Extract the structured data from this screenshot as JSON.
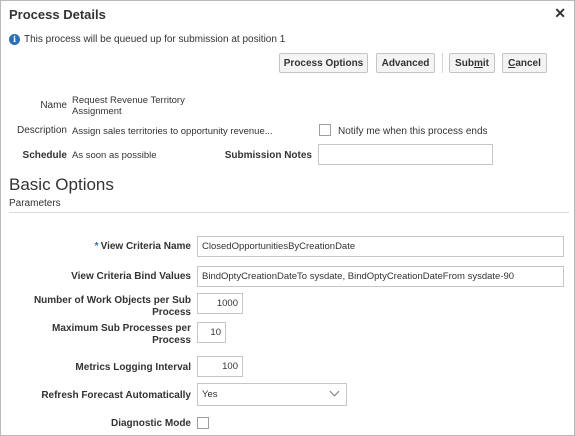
{
  "dialog": {
    "title": "Process Details",
    "close_icon": "close-icon",
    "info_message": "This process will be queued up for submission at position 1"
  },
  "toolbar": {
    "process_options": "Process Options",
    "advanced": "Advanced",
    "submit_pre": "Sub",
    "submit_u": "m",
    "submit_post": "it",
    "cancel_u": "C",
    "cancel_post": "ancel"
  },
  "details": {
    "name_label": "Name",
    "name_line1": "Request Revenue Territory",
    "name_line2": "Assignment",
    "description_label": "Description",
    "description_value": "Assign sales territories to opportunity revenue...",
    "notify_label": "Notify me when this process ends",
    "schedule_label": "Schedule",
    "schedule_value": "As soon as possible",
    "submission_notes_label": "Submission Notes",
    "submission_notes_value": ""
  },
  "basic_options": {
    "heading": "Basic Options",
    "parameters_label": "Parameters"
  },
  "params": {
    "required_marker": "*",
    "view_criteria_name_label": "View Criteria Name",
    "view_criteria_name_value": "ClosedOpportunitiesByCreationDate",
    "bind_values_label": "View Criteria Bind Values",
    "bind_values_value": "BindOptyCreationDateTo sysdate, BindOptyCreationDateFrom sysdate-90",
    "work_objects_label_1": "Number of Work Objects per Sub",
    "work_objects_label_2": "Process",
    "work_objects_value": "1000",
    "max_sub_label_1": "Maximum Sub Processes per",
    "max_sub_label_2": "Process",
    "max_sub_value": "10",
    "metrics_label": "Metrics Logging Interval",
    "metrics_value": "100",
    "refresh_label": "Refresh Forecast Automatically",
    "refresh_value": "Yes",
    "diagnostic_label": "Diagnostic Mode"
  },
  "colors": {
    "info_icon": "#2b6fb6",
    "required_star": "#2b6fb6"
  }
}
